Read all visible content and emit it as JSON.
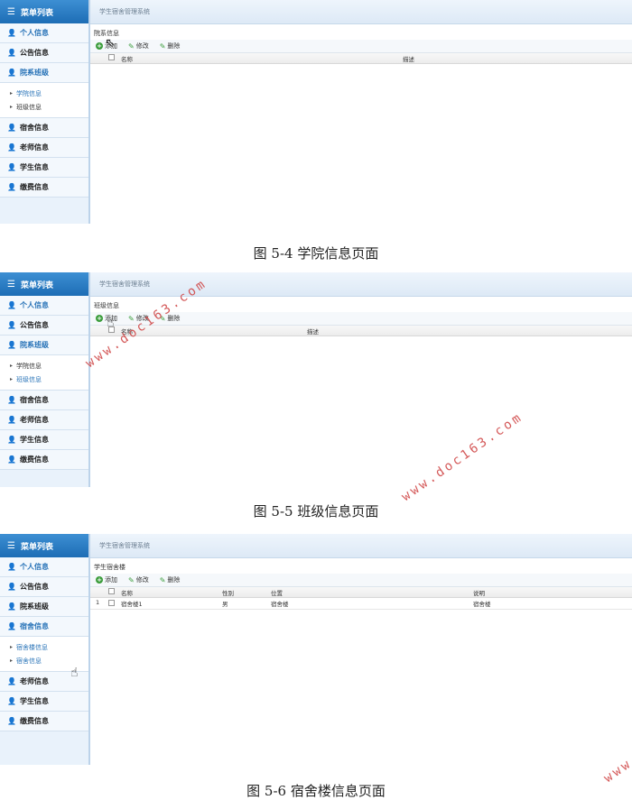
{
  "watermark": "www.doc163.com",
  "figures": [
    {
      "caption": "图 5-4 学院信息页面",
      "ui": {
        "sidebar_title": "菜单列表",
        "menu": [
          "个人信息",
          "公告信息",
          "院系班级"
        ],
        "submenu": [
          "学院信息",
          "班级信息"
        ],
        "menu_after": [
          "宿舍信息",
          "老师信息",
          "学生信息",
          "缴费信息"
        ],
        "system_title": "学生宿舍管理系统",
        "panel_title": "院系信息",
        "toolbar": {
          "add": "添加",
          "edit": "修改",
          "delete": "删除"
        },
        "columns": [
          "名称",
          "描述"
        ],
        "rows": []
      }
    },
    {
      "caption": "图 5-5 班级信息页面",
      "ui": {
        "sidebar_title": "菜单列表",
        "menu": [
          "个人信息",
          "公告信息",
          "院系班级"
        ],
        "submenu": [
          "学院信息",
          "班级信息"
        ],
        "menu_after": [
          "宿舍信息",
          "老师信息",
          "学生信息",
          "缴费信息"
        ],
        "system_title": "学生宿舍管理系统",
        "panel_title": "班级信息",
        "toolbar": {
          "add": "添加",
          "edit": "修改",
          "delete": "删除"
        },
        "columns": [
          "名称",
          "描述"
        ],
        "rows": []
      }
    },
    {
      "caption": "图 5-6 宿舍楼信息页面",
      "ui": {
        "sidebar_title": "菜单列表",
        "menu": [
          "个人信息",
          "公告信息",
          "院系班级",
          "宿舍信息"
        ],
        "submenu": [
          "宿舍楼信息",
          "宿舍信息"
        ],
        "menu_after": [
          "老师信息",
          "学生信息",
          "缴费信息"
        ],
        "system_title": "学生宿舍管理系统",
        "panel_title": "学生宿舍楼",
        "toolbar": {
          "add": "添加",
          "edit": "修改",
          "delete": "删除"
        },
        "columns": [
          "名称",
          "性别",
          "位置",
          "说明"
        ],
        "rows": [
          {
            "index": "1",
            "cells": [
              "宿舍楼1",
              "男",
              "宿舍楼",
              "宿舍楼"
            ]
          }
        ]
      }
    }
  ]
}
